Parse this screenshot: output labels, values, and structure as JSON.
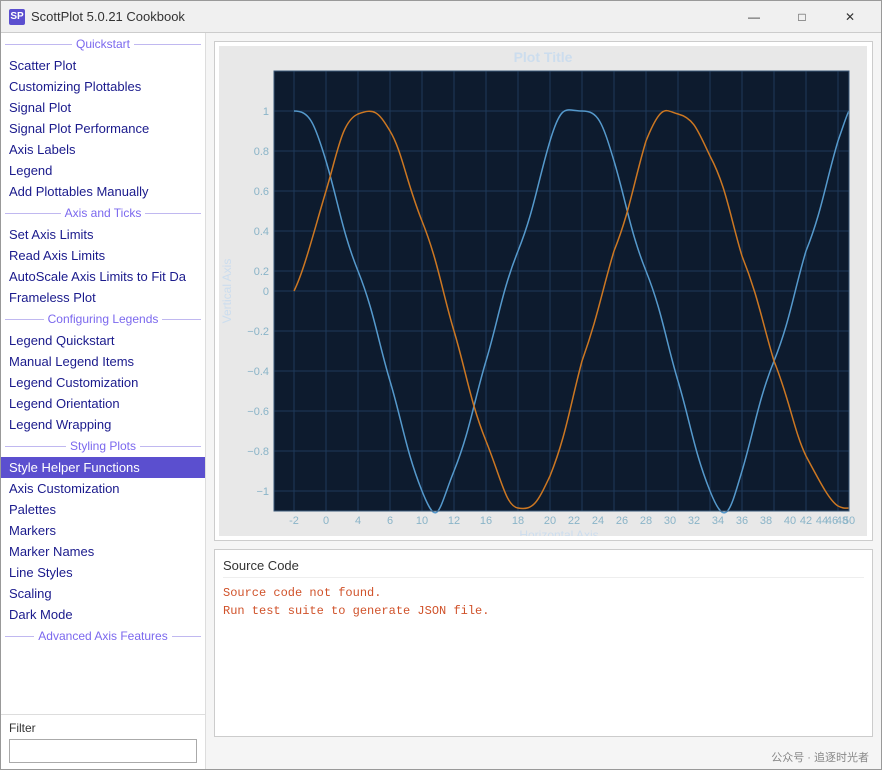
{
  "window": {
    "title": "ScottPlot 5.0.21 Cookbook",
    "icon_label": "SP"
  },
  "titlebar": {
    "minimize": "—",
    "maximize": "□",
    "close": "✕"
  },
  "sidebar": {
    "sections": [
      {
        "type": "header",
        "label": "Quickstart"
      },
      {
        "type": "item",
        "label": "Scatter Plot",
        "id": "scatter-plot"
      },
      {
        "type": "item",
        "label": "Customizing Plottables",
        "id": "customizing-plottables"
      },
      {
        "type": "item",
        "label": "Signal Plot",
        "id": "signal-plot"
      },
      {
        "type": "item",
        "label": "Signal Plot Performance",
        "id": "signal-plot-performance"
      },
      {
        "type": "item",
        "label": "Axis Labels",
        "id": "axis-labels"
      },
      {
        "type": "item",
        "label": "Legend",
        "id": "legend"
      },
      {
        "type": "item",
        "label": "Add Plottables Manually",
        "id": "add-plottables-manually"
      },
      {
        "type": "header",
        "label": "Axis and Ticks"
      },
      {
        "type": "item",
        "label": "Set Axis Limits",
        "id": "set-axis-limits"
      },
      {
        "type": "item",
        "label": "Read Axis Limits",
        "id": "read-axis-limits"
      },
      {
        "type": "item",
        "label": "AutoScale Axis Limits to Fit Da",
        "id": "autoscale-axis-limits"
      },
      {
        "type": "item",
        "label": "Frameless Plot",
        "id": "frameless-plot"
      },
      {
        "type": "header",
        "label": "Configuring Legends"
      },
      {
        "type": "item",
        "label": "Legend Quickstart",
        "id": "legend-quickstart"
      },
      {
        "type": "item",
        "label": "Manual Legend Items",
        "id": "manual-legend-items"
      },
      {
        "type": "item",
        "label": "Legend Customization",
        "id": "legend-customization"
      },
      {
        "type": "item",
        "label": "Legend Orientation",
        "id": "legend-orientation"
      },
      {
        "type": "item",
        "label": "Legend Wrapping",
        "id": "legend-wrapping"
      },
      {
        "type": "header",
        "label": "Styling Plots"
      },
      {
        "type": "item",
        "label": "Style Helper Functions",
        "id": "style-helper-functions",
        "active": true
      },
      {
        "type": "item",
        "label": "Axis Customization",
        "id": "axis-customization"
      },
      {
        "type": "item",
        "label": "Palettes",
        "id": "palettes"
      },
      {
        "type": "item",
        "label": "Markers",
        "id": "markers"
      },
      {
        "type": "item",
        "label": "Marker Names",
        "id": "marker-names"
      },
      {
        "type": "item",
        "label": "Line Styles",
        "id": "line-styles"
      },
      {
        "type": "item",
        "label": "Scaling",
        "id": "scaling"
      },
      {
        "type": "item",
        "label": "Dark Mode",
        "id": "dark-mode"
      },
      {
        "type": "header",
        "label": "Advanced Axis Features"
      }
    ],
    "filter_label": "Filter",
    "filter_placeholder": ""
  },
  "plot": {
    "title": "Plot Title",
    "x_axis_label": "Horizontal Axis",
    "y_axis_label": "Vertical Axis",
    "bg_color": "#0d1b2e",
    "grid_color": "#1e3a5a",
    "axis_color": "#4a6fa5"
  },
  "source": {
    "title": "Source Code",
    "lines": [
      "Source code not found.",
      "Run test suite to generate JSON file."
    ]
  },
  "watermark": "公众号 · 追逐时光者"
}
